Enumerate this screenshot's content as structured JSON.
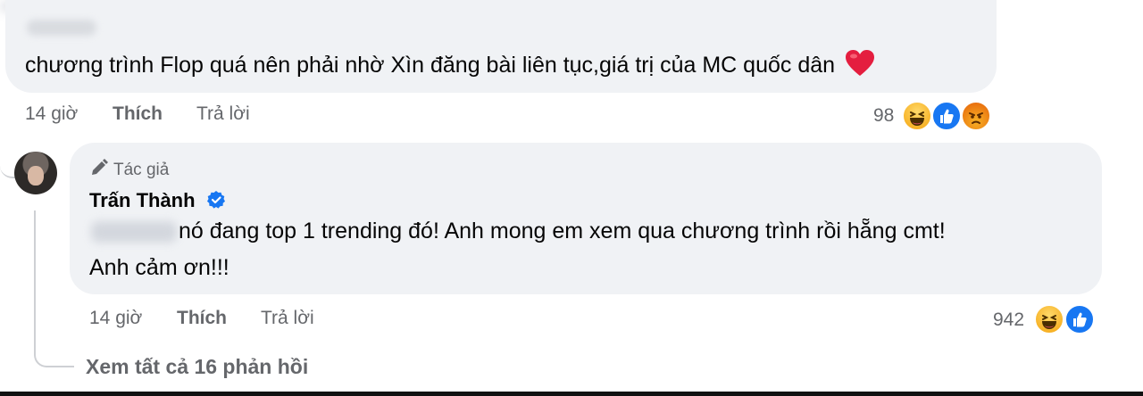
{
  "comment1": {
    "text": "chương trình Flop quá nên phải nhờ Xìn đăng bài liên tục,giá trị của MC quốc dân",
    "emoji": "heart-icon",
    "time": "14 giờ",
    "like_label": "Thích",
    "reply_label": "Trả lời",
    "reaction_count": "98",
    "reactions": [
      "haha-icon",
      "like-icon",
      "angry-icon"
    ]
  },
  "reply": {
    "author_badge": "Tác giả",
    "author_name": "Trấn Thành",
    "line1": "nó đang top 1 trending đó! Anh mong em xem qua chương trình rồi hẵng cmt!",
    "line2": "Anh cảm ơn!!!",
    "time": "14 giờ",
    "like_label": "Thích",
    "reply_label": "Trả lời",
    "reaction_count": "942",
    "reactions": [
      "haha-icon",
      "like-icon"
    ]
  },
  "view_replies_label": "Xem tất cả 16 phản hồi",
  "colors": {
    "bubble": "#f0f2f5",
    "meta_text": "#65676b",
    "like_blue": "#1877f2",
    "heart_red": "#e41e3f"
  }
}
